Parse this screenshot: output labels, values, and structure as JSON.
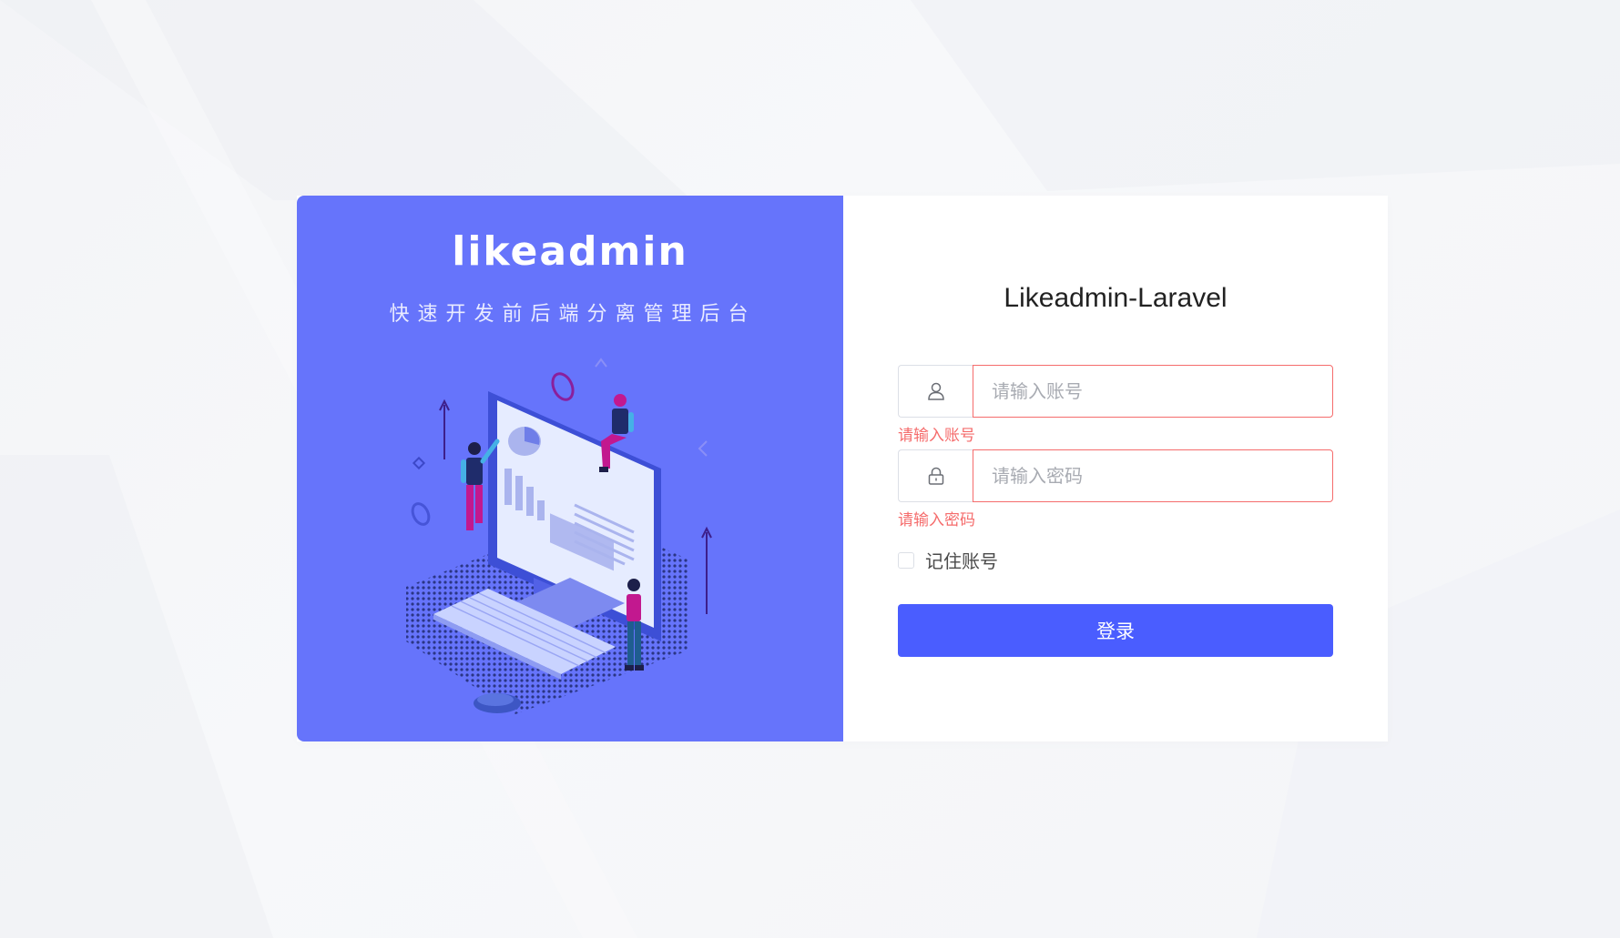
{
  "brand": {
    "logo_text": "likeadmin",
    "tagline": "快速开发前后端分离管理后台"
  },
  "form": {
    "title": "Likeadmin-Laravel",
    "account": {
      "placeholder": "请输入账号",
      "error": "请输入账号",
      "icon": "user-icon"
    },
    "password": {
      "placeholder": "请输入密码",
      "error": "请输入密码",
      "icon": "lock-icon"
    },
    "remember_label": "记住账号",
    "remember_checked": false,
    "submit_label": "登录"
  },
  "colors": {
    "brand_panel": "#6674fb",
    "primary_button": "#4a5dff",
    "error": "#f56c6c",
    "page_background": "#f5f6f8"
  }
}
